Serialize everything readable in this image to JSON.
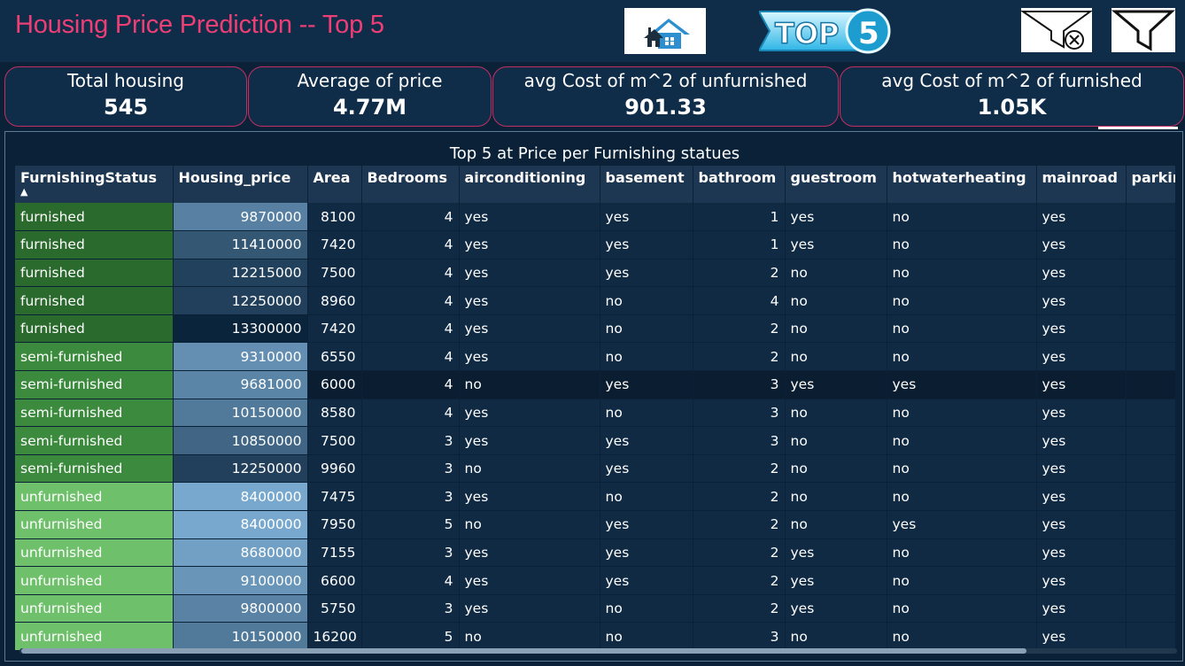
{
  "header": {
    "title": "Housing Price Prediction -- Top 5",
    "top5_text": "TOP",
    "top5_num": "5"
  },
  "kpis": [
    {
      "label": "Total housing",
      "value": "545"
    },
    {
      "label": "Average of price",
      "value": "4.77M"
    },
    {
      "label": "avg Cost of m^2 of unfurnished",
      "value": "901.33"
    },
    {
      "label": "avg Cost of m^2 of furnished",
      "value": "1.05K"
    }
  ],
  "table": {
    "title": "Top 5 at Price per Furnishing statues",
    "columns": [
      "FurnishingStatus",
      "Housing_price",
      "Area",
      "Bedrooms",
      "airconditioning",
      "basement",
      "bathroom",
      "guestroom",
      "hotwaterheating",
      "mainroad",
      "parking"
    ],
    "sort_indicator": "▲",
    "rows": [
      [
        "furnished",
        "9870000",
        "8100",
        "4",
        "yes",
        "yes",
        "1",
        "yes",
        "no",
        "yes",
        ""
      ],
      [
        "furnished",
        "11410000",
        "7420",
        "4",
        "yes",
        "yes",
        "1",
        "yes",
        "no",
        "yes",
        ""
      ],
      [
        "furnished",
        "12215000",
        "7500",
        "4",
        "yes",
        "yes",
        "2",
        "no",
        "no",
        "yes",
        ""
      ],
      [
        "furnished",
        "12250000",
        "8960",
        "4",
        "yes",
        "no",
        "4",
        "no",
        "no",
        "yes",
        ""
      ],
      [
        "furnished",
        "13300000",
        "7420",
        "4",
        "yes",
        "no",
        "2",
        "no",
        "no",
        "yes",
        ""
      ],
      [
        "semi-furnished",
        "9310000",
        "6550",
        "4",
        "yes",
        "no",
        "2",
        "no",
        "no",
        "yes",
        ""
      ],
      [
        "semi-furnished",
        "9681000",
        "6000",
        "4",
        "no",
        "yes",
        "3",
        "yes",
        "yes",
        "yes",
        ""
      ],
      [
        "semi-furnished",
        "10150000",
        "8580",
        "4",
        "yes",
        "no",
        "3",
        "no",
        "no",
        "yes",
        ""
      ],
      [
        "semi-furnished",
        "10850000",
        "7500",
        "3",
        "yes",
        "yes",
        "3",
        "no",
        "no",
        "yes",
        ""
      ],
      [
        "semi-furnished",
        "12250000",
        "9960",
        "3",
        "no",
        "yes",
        "2",
        "no",
        "no",
        "yes",
        ""
      ],
      [
        "unfurnished",
        "8400000",
        "7475",
        "3",
        "yes",
        "no",
        "2",
        "no",
        "no",
        "yes",
        ""
      ],
      [
        "unfurnished",
        "8400000",
        "7950",
        "5",
        "no",
        "yes",
        "2",
        "no",
        "yes",
        "yes",
        ""
      ],
      [
        "unfurnished",
        "8680000",
        "7155",
        "3",
        "yes",
        "yes",
        "2",
        "yes",
        "no",
        "yes",
        ""
      ],
      [
        "unfurnished",
        "9100000",
        "6600",
        "4",
        "yes",
        "yes",
        "2",
        "yes",
        "no",
        "yes",
        ""
      ],
      [
        "unfurnished",
        "9800000",
        "5750",
        "3",
        "yes",
        "no",
        "2",
        "yes",
        "no",
        "yes",
        ""
      ],
      [
        "unfurnished",
        "10150000",
        "16200",
        "5",
        "no",
        "no",
        "3",
        "no",
        "no",
        "yes",
        ""
      ]
    ]
  },
  "colors": {
    "title": "#ee3e76",
    "kpi_border": "#c42f63",
    "furnished": "#2a6a2c",
    "semi-furnished": "#3b8a3d",
    "unfurnished": "#6ec06b"
  }
}
